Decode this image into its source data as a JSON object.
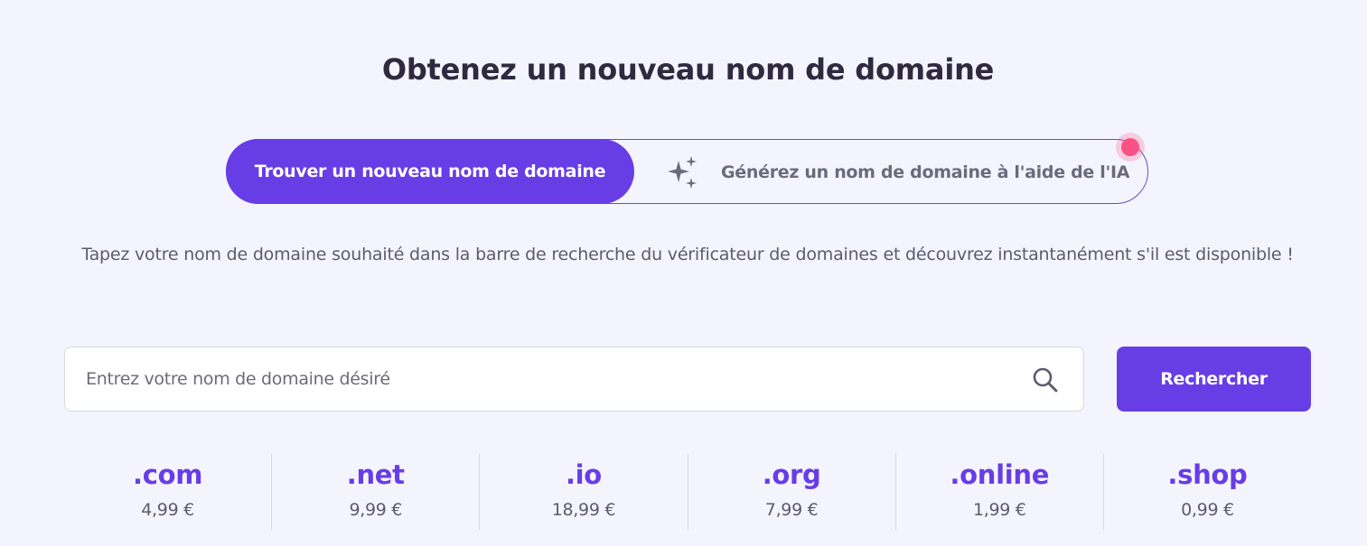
{
  "header": {
    "title": "Obtenez un nouveau nom de domaine"
  },
  "toggle": {
    "find_label": "Trouver un nouveau nom de domaine",
    "ai_label": "Générez un nom de domaine à l'aide de l'IA",
    "ai_icon": "sparkles-icon",
    "notification_icon": "notification-dot"
  },
  "description": "Tapez votre nom de domaine souhaité dans la barre de recherche du vérificateur de domaines et découvrez instantanément s'il est disponible !",
  "search": {
    "placeholder": "Entrez votre nom de domaine désiré",
    "value": "",
    "icon": "search-icon",
    "button_label": "Rechercher"
  },
  "tlds": [
    {
      "ext": ".com",
      "price": "4,99 €"
    },
    {
      "ext": ".net",
      "price": "9,99 €"
    },
    {
      "ext": ".io",
      "price": "18,99 €"
    },
    {
      "ext": ".org",
      "price": "7,99 €"
    },
    {
      "ext": ".online",
      "price": "1,99 €"
    },
    {
      "ext": ".shop",
      "price": "0,99 €"
    }
  ],
  "colors": {
    "accent": "#673de6",
    "background": "#f4f4fe",
    "notification": "#fc5185"
  }
}
